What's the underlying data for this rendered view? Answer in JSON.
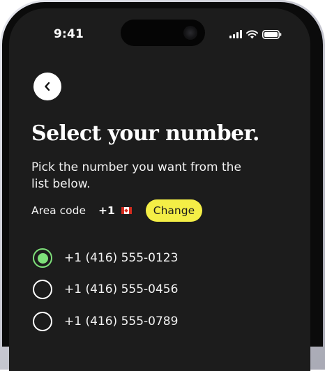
{
  "status_bar": {
    "time": "9:41",
    "icons": [
      "cellular-signal-icon",
      "wifi-icon",
      "battery-icon"
    ]
  },
  "header": {
    "back_icon": "chevron-left-icon",
    "title": "Select your number.",
    "subtitle": "Pick the number you want from the list below."
  },
  "area": {
    "label": "Area code",
    "code": "+1",
    "flag": "canada-flag-icon",
    "change_label": "Change"
  },
  "numbers": [
    {
      "number": "+1 (416) 555-0123",
      "selected": true
    },
    {
      "number": "+1 (416) 555-0456",
      "selected": false
    },
    {
      "number": "+1 (416) 555-0789",
      "selected": false
    }
  ],
  "colors": {
    "background": "#1c1c1c",
    "accent_yellow": "#f4ee46",
    "accent_green": "#7ee07a",
    "text": "#ffffff"
  }
}
